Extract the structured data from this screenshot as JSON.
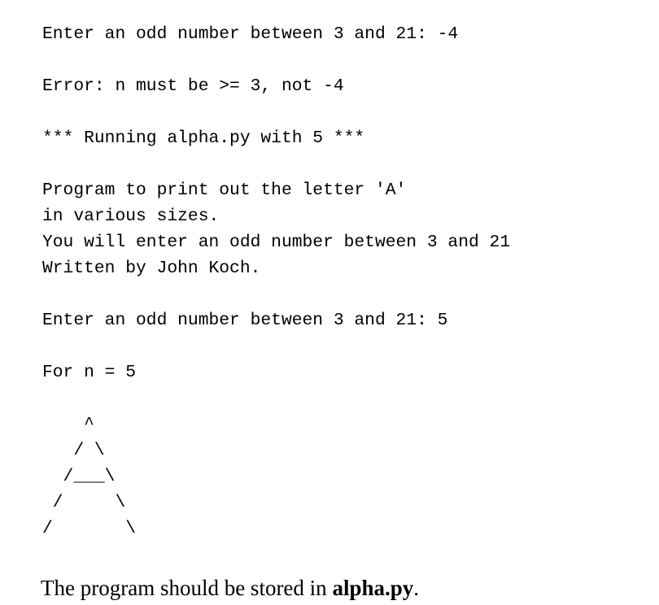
{
  "page": {
    "background_color": "#ffffff",
    "text_color": "#000000"
  },
  "console": {
    "lines": [
      "Enter an odd number between 3 and 21: -4",
      "",
      "Error: n must be >= 3, not -4",
      "",
      "*** Running alpha.py with 5 ***",
      "",
      "Program to print out the letter 'A'",
      "in various sizes.",
      "You will enter an odd number between 3 and 21",
      "Written by John Koch.",
      "",
      "Enter an odd number between 3 and 21: 5",
      "",
      "For n = 5",
      ""
    ],
    "prompt_1": "Enter an odd number between 3 and 21: -4",
    "entered_value_1": "-4",
    "error_message": "Error: n must be >= 3, not -4",
    "run_banner": "*** Running alpha.py with 5 ***",
    "banner_lines": [
      "Program to print out the letter 'A'",
      "in various sizes.",
      "You will enter an odd number between 3 and 21",
      "Written by John Koch."
    ],
    "prompt_2": "Enter an odd number between 3 and 21: 5",
    "entered_value_2": "5",
    "for_n_label": "For n = 5",
    "n_value": "5",
    "script_name": "alpha.py",
    "author": "John Koch",
    "range_min": "3",
    "range_max": "21"
  },
  "ascii_art": {
    "letter": "A",
    "size": "5",
    "rows": [
      "    ^",
      "   / \\",
      "  /___\\",
      " /     \\",
      "/       \\"
    ]
  },
  "footer": {
    "text_before": "The program should be stored in ",
    "filename": "alpha.py",
    "text_after": "."
  }
}
